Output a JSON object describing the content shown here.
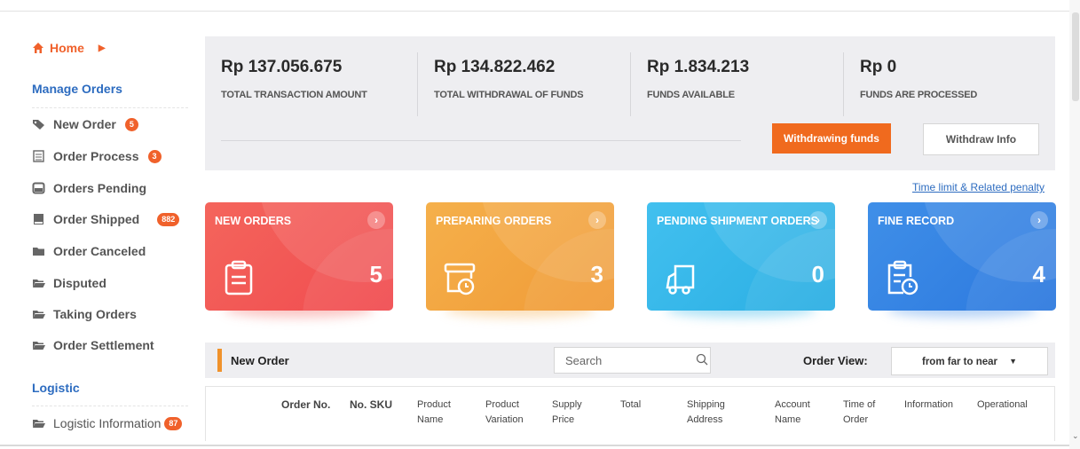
{
  "sidebar": {
    "home": "Home",
    "manage_orders_heading": "Manage Orders",
    "items": [
      {
        "label": "New Order",
        "badge": "5",
        "icon": "tags-icon"
      },
      {
        "label": "Order Process",
        "badge": "3",
        "icon": "list-icon"
      },
      {
        "label": "Orders Pending",
        "badge": "",
        "icon": "inbox-icon"
      },
      {
        "label": "Order Shipped",
        "badge": "882",
        "icon": "book-icon"
      },
      {
        "label": "Order Canceled",
        "badge": "",
        "icon": "folder-icon"
      },
      {
        "label": "Disputed",
        "badge": "",
        "icon": "folder-open-icon"
      },
      {
        "label": "Taking Orders",
        "badge": "",
        "icon": "folder-open-icon"
      },
      {
        "label": "Order Settlement",
        "badge": "",
        "icon": "folder-open-icon"
      }
    ],
    "logistic_heading": "Logistic",
    "logistic_item": {
      "label": "Logistic Information",
      "badge": "87"
    }
  },
  "summary": {
    "stats": [
      {
        "amount": "Rp 137.056.675",
        "label": "TOTAL TRANSACTION AMOUNT"
      },
      {
        "amount": "Rp 134.822.462",
        "label": "TOTAL WITHDRAWAL OF FUNDS"
      },
      {
        "amount": "Rp 1.834.213",
        "label": "FUNDS AVAILABLE"
      },
      {
        "amount": "Rp 0",
        "label": "FUNDS ARE PROCESSED"
      }
    ],
    "withdraw_button": "Withdrawing funds",
    "info_button": "Withdraw Info"
  },
  "penalty_link": "Time limit & Related penalty",
  "cards": [
    {
      "title": "NEW ORDERS",
      "count": "5",
      "icon": "clipboard-icon",
      "color": "#f25b55"
    },
    {
      "title": "PREPARING ORDERS",
      "count": "3",
      "icon": "box-clock-icon",
      "color": "#f3a640"
    },
    {
      "title": "PENDING SHIPMENT ORDERS",
      "count": "0",
      "icon": "truck-icon",
      "color": "#36b6e8"
    },
    {
      "title": "FINE RECORD",
      "count": "4",
      "icon": "clipboard-clock-icon",
      "color": "#3584e4"
    }
  ],
  "orders": {
    "title": "New Order",
    "search_placeholder": "Search",
    "view_label": "Order View:",
    "view_value": "from far to near",
    "columns": [
      "Order No.",
      "No. SKU",
      "Product Name",
      "Product Variation",
      "Supply Price",
      "Total",
      "Shipping Address",
      "Account Name",
      "Time of Order",
      "Information",
      "Operational"
    ]
  }
}
